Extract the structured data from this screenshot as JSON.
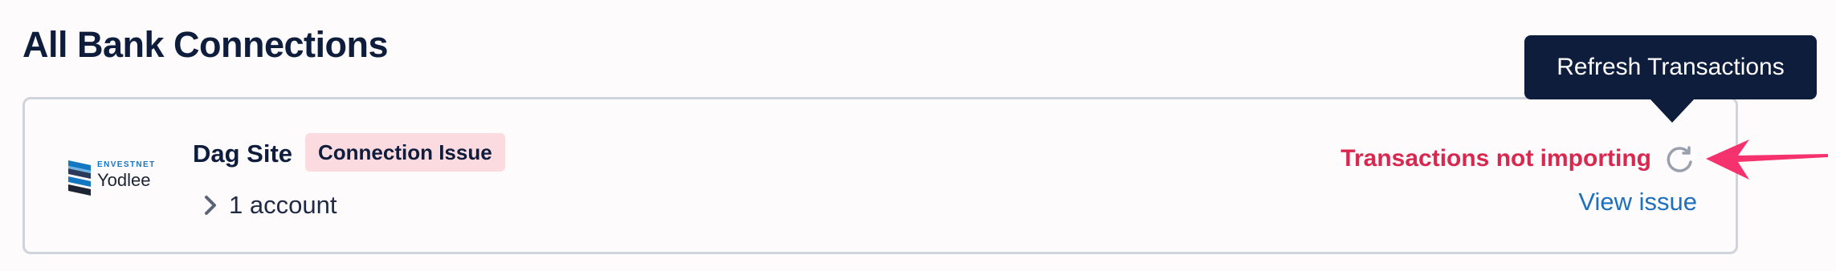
{
  "page": {
    "title": "All Bank Connections"
  },
  "connection": {
    "logo": {
      "brand_top": "ENVESTNET",
      "brand_main": "Yodlee",
      "icon": "yodlee-logo"
    },
    "site_name": "Dag Site",
    "badge": "Connection Issue",
    "accounts_label": "1 account",
    "status": "Transactions not importing",
    "view_issue_label": "View issue",
    "refresh_icon": "refresh-icon",
    "chevron_icon": "chevron-right-icon"
  },
  "tooltip": {
    "text": "Refresh Transactions"
  },
  "colors": {
    "title": "#0f1d3d",
    "status_error": "#d9284f",
    "badge_bg": "#fbdbe0",
    "link": "#1d6fbf",
    "tooltip_bg": "#0f1d3d",
    "annotation_arrow": "#f5326e",
    "card_border": "#cfd3db"
  }
}
